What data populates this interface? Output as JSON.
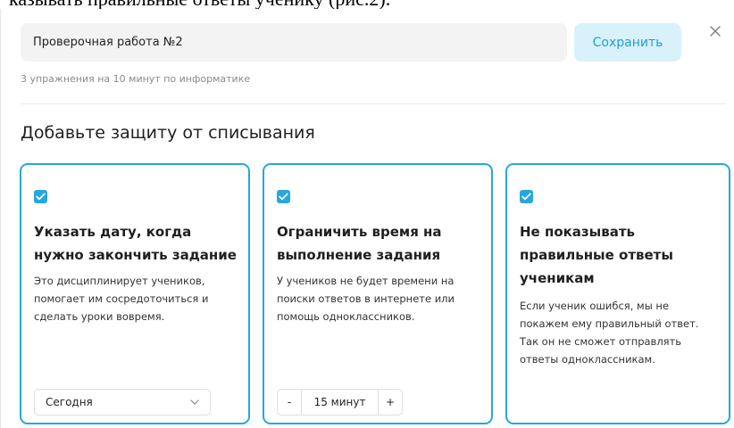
{
  "document": {
    "cut_text": "казывать правильные ответы ученику (рис.2)."
  },
  "modal": {
    "title_value": "Проверочная работа №2",
    "save_label": "Сохранить",
    "close_symbol": "×",
    "subtitle": "3 упражнения на 10 минут по информатике",
    "section_title": "Добавьте защиту от списывания"
  },
  "cards": [
    {
      "checked": true,
      "title": "Указать дату, когда нужно закончить задание",
      "description": "Это дисциплинирует учеников, помогает им сосредоточиться и сделать уроки вовремя.",
      "select_value": "Сегодня"
    },
    {
      "checked": true,
      "title": "Ограничить время на выполнение задания",
      "description": "У учеников не будет времени на поиски ответов в интернете или помощь одноклассников.",
      "stepper": {
        "minus": "-",
        "value": "15 минут",
        "plus": "+"
      }
    },
    {
      "checked": true,
      "title": "Не показывать правильные ответы ученикам",
      "description": "Если ученик ошибся, мы не покажем ему правильный ответ. Так он не сможет отправлять ответы одноклассникам."
    }
  ],
  "colors": {
    "accent": "#26a7df",
    "save_bg": "#d9f1fb",
    "save_text": "#1aa0d8",
    "input_bg": "#f3f3f4"
  },
  "icons": {
    "close": "close-icon",
    "checkbox": "checkmark-icon",
    "select": "chevron-down-icon"
  }
}
